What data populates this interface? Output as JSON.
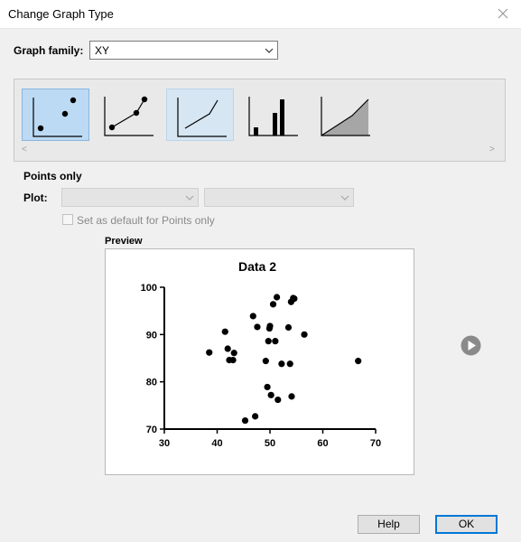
{
  "dialog": {
    "title": "Change Graph Type"
  },
  "graph_family": {
    "label": "Graph family:",
    "value": "XY"
  },
  "gallery": {
    "items": [
      {
        "name": "points-only",
        "state": "selected"
      },
      {
        "name": "connecting-line-and-points",
        "state": "normal"
      },
      {
        "name": "line-only",
        "state": "hover"
      },
      {
        "name": "column-spikes",
        "state": "normal"
      },
      {
        "name": "area-fill",
        "state": "normal"
      }
    ],
    "scroll_left": "<",
    "scroll_right": ">"
  },
  "selected_type_title": "Points only",
  "plot": {
    "label": "Plot:",
    "select1_value": "",
    "select2_value": ""
  },
  "default_checkbox": {
    "label": "Set as default for Points only",
    "checked": false
  },
  "preview": {
    "label": "Preview",
    "chart_data": {
      "type": "scatter",
      "title": "Data 2",
      "xlabel": "",
      "ylabel": "",
      "xlim": [
        30,
        70
      ],
      "ylim": [
        70,
        100
      ],
      "x_ticks": [
        "30",
        "40",
        "50",
        "60",
        "70"
      ],
      "y_ticks": [
        "70",
        "80",
        "90",
        "100"
      ],
      "x": [
        38.5,
        41.5,
        42,
        42.3,
        43,
        43.2,
        45.3,
        46.8,
        47.2,
        47.6,
        49.2,
        49.5,
        49.7,
        49.9,
        50,
        50.2,
        50.6,
        51,
        51.3,
        51.5,
        52.2,
        53.5,
        53.8,
        54,
        54.1,
        54.4,
        54.6,
        56.5,
        66.7
      ],
      "y": [
        86.2,
        90.6,
        87,
        84.6,
        84.6,
        86.1,
        71.8,
        93.9,
        72.7,
        91.6,
        84.4,
        78.9,
        88.6,
        91.3,
        91.8,
        77.2,
        96.4,
        88.6,
        97.9,
        76.2,
        83.8,
        91.5,
        83.8,
        96.9,
        76.9,
        97.7,
        97.6,
        90,
        84.4
      ]
    }
  },
  "buttons": {
    "help": "Help",
    "ok": "OK"
  },
  "colors": {
    "accent": "#0078d7",
    "selected_bg": "#bcdaf4",
    "hover_bg": "#d6e6f3"
  }
}
